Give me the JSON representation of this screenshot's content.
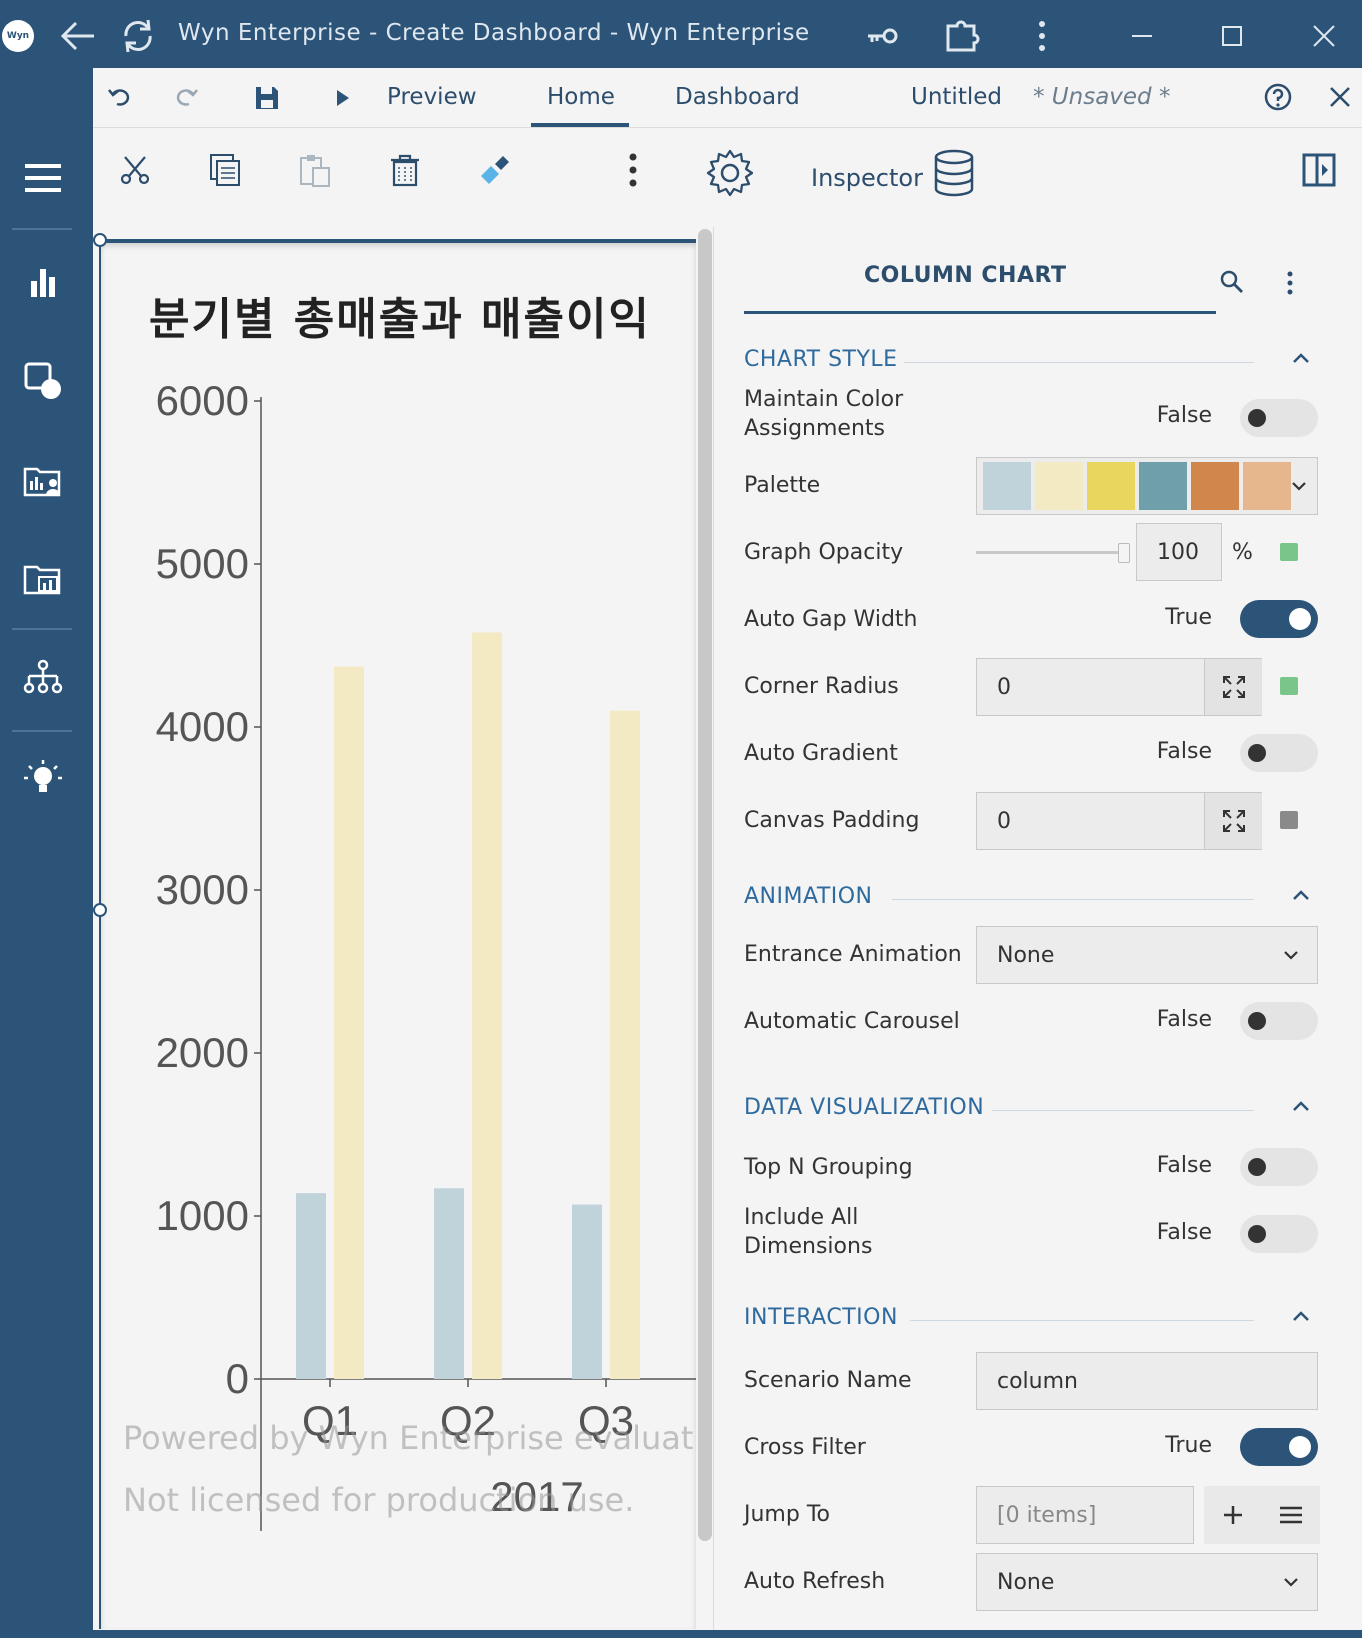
{
  "window": {
    "title": "Wyn Enterprise - Create Dashboard - Wyn Enterprise",
    "logo_text": "Wyn"
  },
  "menubar": {
    "preview_label": "Preview",
    "home_label": "Home",
    "dashboard_label": "Dashboard",
    "doc_name": "Untitled",
    "unsaved": "* Unsaved *"
  },
  "toolbar": {
    "inspector_label": "Inspector"
  },
  "colors": {
    "accent": "#2c5378",
    "section_text": "#2e6a9e",
    "series_1": "#c0d3da",
    "series_2": "#f3eac3",
    "indicator_green": "#7ac58a",
    "indicator_gray": "#8a8a8a"
  },
  "watermark": {
    "line1": "Powered by Wyn Enterprise evaluation edition.",
    "line2": "Not licensed for production use."
  },
  "chart_data": {
    "type": "bar",
    "title": "분기별 총매출과 매출이익",
    "categories": [
      "Q1",
      "Q2",
      "Q3"
    ],
    "group_label": "2017",
    "series": [
      {
        "values": [
          1140,
          1170,
          1070
        ],
        "color": "#c0d3da"
      },
      {
        "values": [
          4370,
          4580,
          4100
        ],
        "color": "#f3eac3"
      }
    ],
    "y_ticks": [
      "0",
      "1000",
      "2000",
      "3000",
      "4000",
      "5000",
      "6000"
    ],
    "ylim": [
      0,
      6000
    ],
    "grid": false
  },
  "inspector": {
    "panel_title": "COLUMN CHART",
    "sections": {
      "chart_style": "CHART STYLE",
      "animation": "ANIMATION",
      "data_visualization": "DATA VISUALIZATION",
      "interaction": "INTERACTION"
    },
    "props": {
      "maintain_color": {
        "label": "Maintain Color Assignments",
        "value": "False"
      },
      "palette": {
        "label": "Palette",
        "swatches": [
          "#c0d3da",
          "#f3eac3",
          "#e8d65e",
          "#6f9fa9",
          "#d1864c",
          "#e6b78c"
        ]
      },
      "graph_opacity": {
        "label": "Graph Opacity",
        "value": "100",
        "unit": "%",
        "level": 1.0
      },
      "auto_gap": {
        "label": "Auto Gap Width",
        "value": "True"
      },
      "corner_radius": {
        "label": "Corner Radius",
        "value": "0"
      },
      "auto_gradient": {
        "label": "Auto Gradient",
        "value": "False"
      },
      "canvas_padding": {
        "label": "Canvas Padding",
        "value": "0"
      },
      "entrance_animation": {
        "label": "Entrance Animation",
        "value": "None"
      },
      "automatic_carousel": {
        "label": "Automatic Carousel",
        "value": "False"
      },
      "top_n": {
        "label": "Top N Grouping",
        "value": "False"
      },
      "include_all": {
        "label": "Include All Dimensions",
        "value": "False"
      },
      "scenario_name": {
        "label": "Scenario Name",
        "value": "column"
      },
      "cross_filter": {
        "label": "Cross Filter",
        "value": "True"
      },
      "jump_to": {
        "label": "Jump To",
        "value": "[0 items]"
      },
      "auto_refresh": {
        "label": "Auto Refresh",
        "value": "None"
      }
    }
  }
}
